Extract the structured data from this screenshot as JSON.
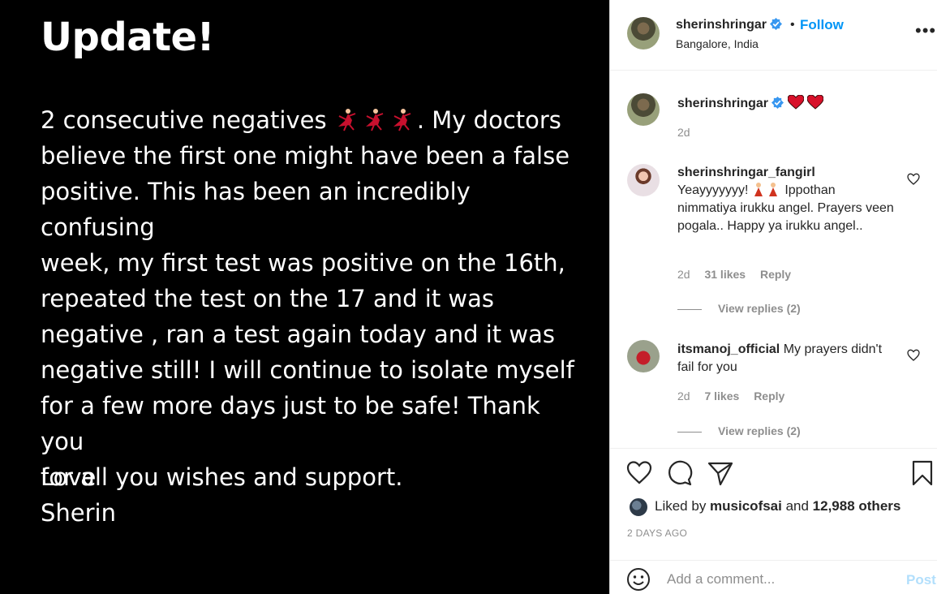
{
  "image": {
    "heading": "Update!",
    "body_prefix": "2 consecutive negatives ",
    "body_text": ". My doctors\nbelieve the first one might have been a false\npositive. This has been an incredibly confusing\nweek, my first test was positive on the 16th,\nrepeated the test on the 17 and it was\nnegative , ran a test again today and it was\nnegative still! I will continue to isolate myself\nfor a few more days just to be safe! Thank you\nfor all you wishes and support.",
    "signoff": "Love\nSherin"
  },
  "header": {
    "username": "sherinshringar",
    "dot": "•",
    "follow_label": "Follow",
    "location": "Bangalore, India",
    "more_label": "•••"
  },
  "caption": {
    "username": "sherinshringar",
    "text": "",
    "time": "2d"
  },
  "comments": [
    {
      "username": "sherinshringar_fangirl",
      "text_before": "Yeayyyyyyy! ",
      "text_after": " Ippothan nimmatiya irukku angel. Prayers veen pogala.. Happy ya irukku angel..",
      "time": "2d",
      "likes": "31 likes",
      "reply": "Reply",
      "view_replies": "View replies (2)"
    },
    {
      "username": "itsmanoj_official",
      "text": "My prayers didn't fail for you",
      "time": "2d",
      "likes": "7 likes",
      "reply": "Reply",
      "view_replies": "View replies (2)"
    }
  ],
  "likes": {
    "prefix": "Liked by ",
    "user": "musicofsai",
    "middle": " and ",
    "others": "12,988 others"
  },
  "date": "2 DAYS AGO",
  "add_comment": {
    "placeholder": "Add a comment...",
    "post_label": "Post"
  },
  "colors": {
    "accent": "#0095f6",
    "post_disabled": "#b2dffc",
    "heart_red": "#ed4956"
  }
}
